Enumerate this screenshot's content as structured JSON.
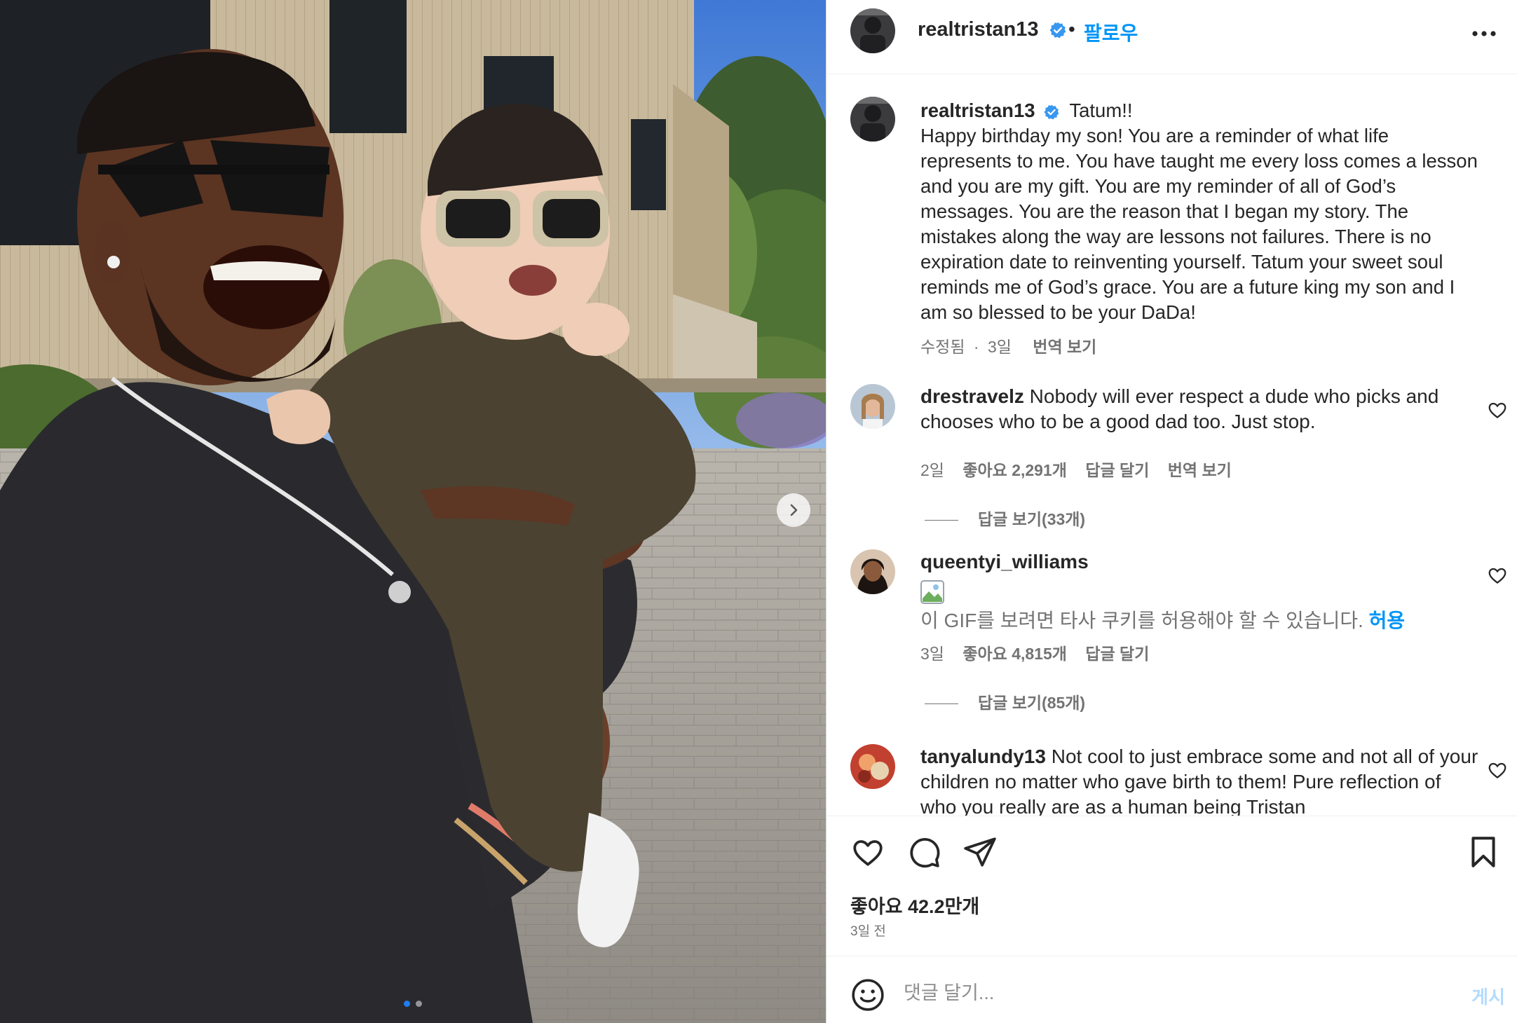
{
  "post": {
    "username": "realtristan13",
    "separator": "•",
    "follow_label": "팔로우",
    "more_icon": "more-options-icon"
  },
  "caption": {
    "username": "realtristan13",
    "first_line": "Tatum!!",
    "text": "Happy birthday my son! You are a reminder of what life represents to me. You have taught me every loss comes a lesson and you are my gift. You are my reminder of all of God’s messages. You are the reason that I began my story. The mistakes along the way are lessons not failures. There is no expiration date to reinventing yourself. Tatum your sweet soul reminds me of God’s grace. You are a future king my son and I am so blessed to be your DaDa!",
    "edited": "수정됨",
    "dot": "·",
    "time": "3일",
    "translate": "번역 보기"
  },
  "comments": [
    {
      "username": "drestravelz",
      "text": "Nobody will ever respect a dude who picks and chooses who to be a good dad too. Just stop.",
      "time": "2일",
      "likes": "좋아요 2,291개",
      "reply": "답글 달기",
      "translate": "번역 보기",
      "view_replies": "답글 보기(33개)"
    },
    {
      "username": "queentyi_williams",
      "gif_notice": "이 GIF를 보려면 타사 쿠키를 허용해야 할 수 있습니다.",
      "allow": "허용",
      "time": "3일",
      "likes": "좋아요 4,815개",
      "reply": "답글 달기",
      "view_replies": "답글 보기(85개)"
    },
    {
      "username": "tanyalundy13",
      "text": "Not cool to just embrace some and not all of your children no matter who gave birth to them! Pure reflection of who you really are as a human being Tristan"
    }
  ],
  "footer": {
    "likes": "좋아요 42.2만개",
    "date": "3일 전",
    "comment_placeholder": "댓글 달기...",
    "post_label": "게시"
  },
  "carousel": {
    "current_index": 1,
    "total": 2
  },
  "colors": {
    "accent": "#0095f6",
    "verified": "#3897f0",
    "muted": "#737373",
    "post_disabled": "#b3dbff"
  }
}
